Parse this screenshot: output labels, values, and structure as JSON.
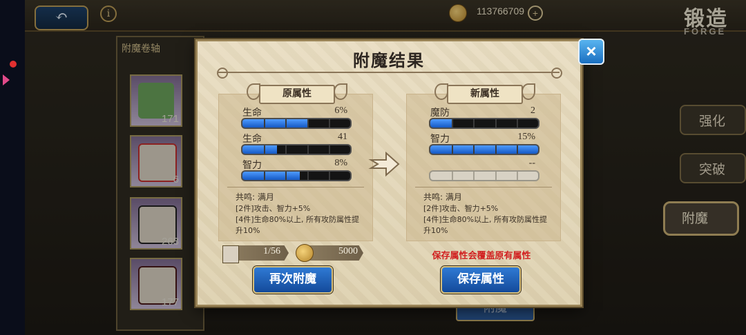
{
  "topbar": {
    "back_icon": "back-arrow-icon",
    "info_icon": "info-icon",
    "gold_amount": "113766709",
    "gold_plus": "+",
    "screen_title": "锻造",
    "screen_subtitle": "FORGE"
  },
  "scroll_panel": {
    "title": "附魔卷轴",
    "items": [
      {
        "count": "171",
        "color": "#6aa15a"
      },
      {
        "count": "6",
        "color": "#d9d0c1"
      },
      {
        "count": "263",
        "color": "#d9d0c1"
      },
      {
        "count": "177",
        "color": "#d9d0c1"
      }
    ]
  },
  "side_menu": {
    "enhance": "强化",
    "breakthrough": "突破",
    "enchant": "附魔"
  },
  "background_button": "附魔",
  "dialog": {
    "title": "附魔结果",
    "close_label": "×",
    "original": {
      "banner": "原属性",
      "stats": [
        {
          "name": "生命",
          "value": "6%",
          "fill": 0.6
        },
        {
          "name": "生命",
          "value": "41",
          "fill": 0.32
        },
        {
          "name": "智力",
          "value": "8%",
          "fill": 0.53
        }
      ],
      "set_title": "共鸣: 满月",
      "set_line1": "[2件]攻击、智力+5%",
      "set_line2": "[4件]生命80%以上, 所有攻防属性提升10%"
    },
    "new": {
      "banner": "新属性",
      "stats": [
        {
          "name": "魔防",
          "value": "2",
          "fill": 0.2
        },
        {
          "name": "智力",
          "value": "15%",
          "fill": 1.0
        },
        {
          "name": "",
          "value": "--",
          "fill": 0
        }
      ],
      "set_title": "共鸣: 满月",
      "set_line1": "[2件]攻击、智力+5%",
      "set_line2": "[4件]生命80%以上, 所有攻防属性提升10%"
    },
    "scroll_cost": "1/56",
    "gold_cost": "5000",
    "warning": "保存属性会覆盖原有属性",
    "reenchant_label": "再次附魔",
    "save_label": "保存属性"
  }
}
